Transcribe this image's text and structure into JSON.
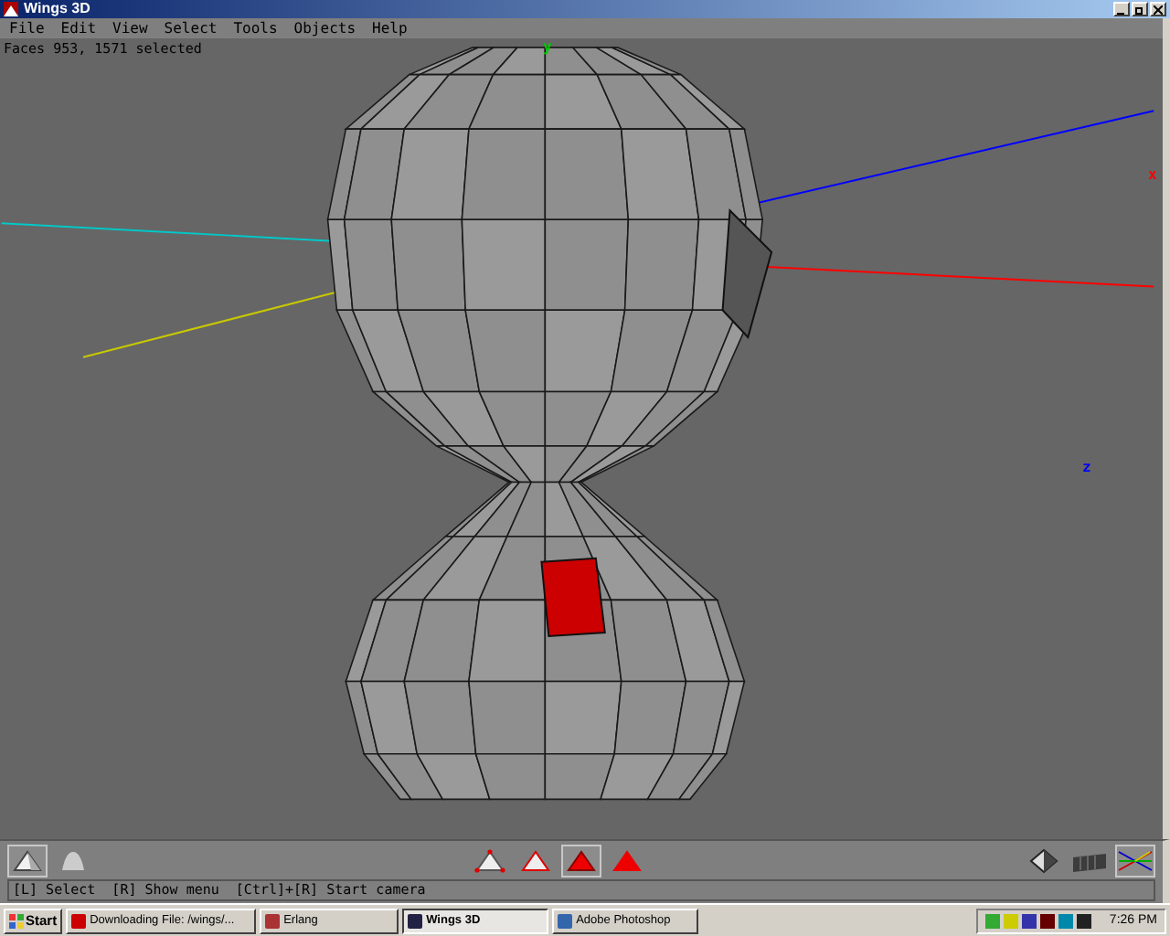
{
  "window": {
    "title": "Wings 3D"
  },
  "menu": [
    "File",
    "Edit",
    "View",
    "Select",
    "Tools",
    "Objects",
    "Help"
  ],
  "viewport": {
    "status": "Faces 953, 1571 selected",
    "axis_labels": [
      {
        "text": "y",
        "color": "#00c800"
      },
      {
        "text": "x",
        "color": "#ff0000"
      },
      {
        "text": "z",
        "color": "#0000ff"
      }
    ]
  },
  "toolbar": {
    "view_modes": [
      {
        "kind": "flat",
        "selected": true
      },
      {
        "kind": "smooth",
        "selected": false
      }
    ],
    "select_modes": [
      {
        "kind": "vertex",
        "selected": false
      },
      {
        "kind": "edge",
        "selected": false
      },
      {
        "kind": "face",
        "selected": true
      },
      {
        "kind": "body",
        "selected": false
      }
    ],
    "display_toggles": [
      {
        "kind": "wireframe",
        "selected": false
      },
      {
        "kind": "groundplane",
        "selected": false
      },
      {
        "kind": "axes",
        "selected": true
      }
    ]
  },
  "info_line": "[L] Select  [R] Show menu  [Ctrl]+[R] Start camera",
  "taskbar": {
    "start": "Start",
    "tasks": [
      {
        "label": "Downloading File: /wings/...",
        "selected": false
      },
      {
        "label": "Erlang",
        "selected": false
      },
      {
        "label": "Wings 3D",
        "selected": true
      },
      {
        "label": "Adobe Photoshop",
        "selected": false
      }
    ],
    "clock": "7:26 PM"
  }
}
